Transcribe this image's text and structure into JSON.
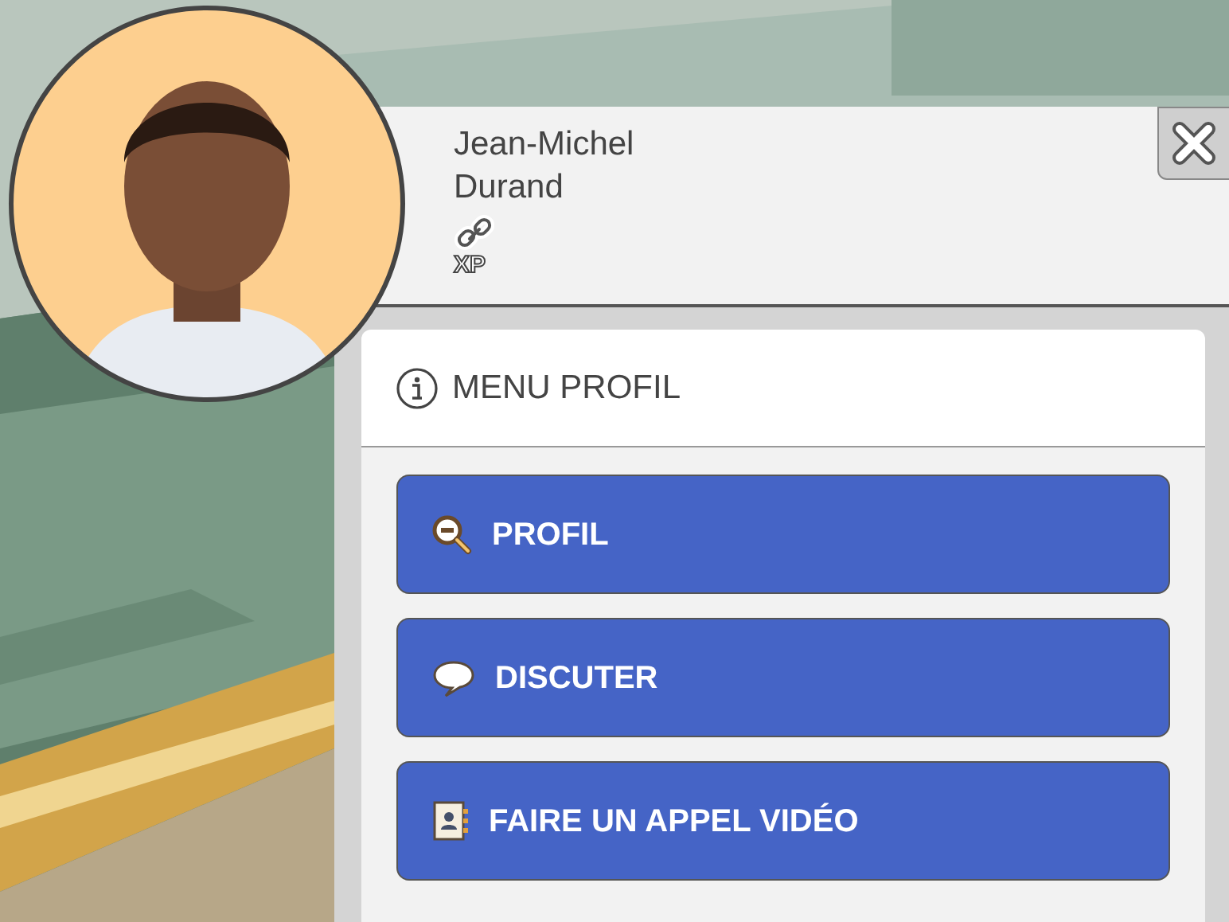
{
  "profile": {
    "first_name": "Jean-Michel",
    "last_name": "Durand",
    "badge": "XP"
  },
  "menu": {
    "title": "MENU PROFIL"
  },
  "buttons": [
    {
      "kind": "zoom",
      "label": "PROFIL"
    },
    {
      "kind": "chat",
      "label": "DISCUTER"
    },
    {
      "kind": "contacts",
      "label": "FAIRE UN APPEL VIDÉO"
    }
  ]
}
